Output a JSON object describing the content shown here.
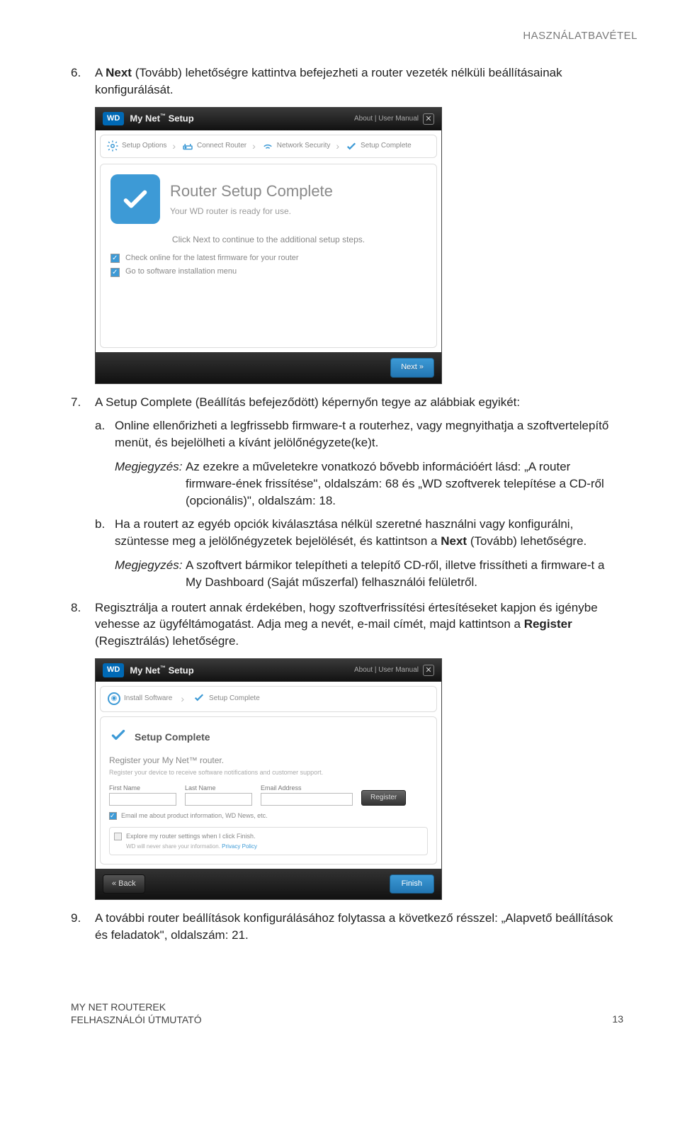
{
  "header": {
    "section": "HASZNÁLATBAVÉTEL"
  },
  "steps": {
    "s6": {
      "num": "6.",
      "text_pre": "A ",
      "text_bold": "Next",
      "text_post": " (Tovább) lehetőségre kattintva befejezheti a router vezeték nélküli beállításainak konfigurálását."
    },
    "s7": {
      "num": "7.",
      "text": "A Setup Complete (Beállítás befejeződött) képernyőn tegye az alábbiak egyikét:"
    },
    "s7a": {
      "letter": "a.",
      "text": "Online ellenőrizheti a legfrissebb firmware-t a routerhez, vagy megnyithatja a szoftvertelepítő menüt, és bejelölheti a kívánt jelölőnégyzete(ke)t."
    },
    "s7a_note": {
      "label": "Megjegyzés:",
      "text": "Az ezekre a műveletekre vonatkozó bővebb információért lásd: „A router firmware-ének frissítése\", oldalszám: 68 és „WD szoftverek telepítése a CD-ről (opcionális)\", oldalszám: 18."
    },
    "s7b": {
      "letter": "b.",
      "text_pre": "Ha a routert az egyéb opciók kiválasztása nélkül szeretné használni vagy konfigurálni, szüntesse meg a jelölőnégyzetek bejelölését, és kattintson a ",
      "text_bold": "Next",
      "text_post": " (Tovább) lehetőségre."
    },
    "s7b_note": {
      "label": "Megjegyzés:",
      "text": "A szoftvert bármikor telepítheti a telepítő CD-ről, illetve frissítheti a firmware-t a My Dashboard (Saját műszerfal) felhasználói felületről."
    },
    "s8": {
      "num": "8.",
      "text_pre": "Regisztrálja a routert annak érdekében, hogy szoftverfrissítési értesítéseket kapjon és igénybe vehesse az ügyféltámogatást. Adja meg a nevét, e-mail címét, majd kattintson a ",
      "text_bold": "Register",
      "text_post": " (Regisztrálás) lehetőségre."
    },
    "s9": {
      "num": "9.",
      "text": "A további router beállítások konfigurálásához folytassa a következő résszel: „Alapvető beállítások és feladatok\", oldalszám: 21."
    }
  },
  "shot1": {
    "logo": "WD",
    "title_pre": "My Net",
    "title_tm": "™",
    "title_post": " Setup",
    "about": "About | User Manual",
    "crumbs": {
      "c1": "Setup Options",
      "c2": "Connect Router",
      "c3": "Network Security",
      "c4": "Setup Complete"
    },
    "complete_title": "Router Setup Complete",
    "complete_sub": "Your WD router is ready for use.",
    "click_next": "Click Next to continue to the additional setup steps.",
    "chk1": "Check online for the latest firmware for your router",
    "chk2": "Go to software installation menu",
    "next": "Next »"
  },
  "shot2": {
    "logo": "WD",
    "title_pre": "My Net",
    "title_tm": "™",
    "title_post": " Setup",
    "about": "About | User Manual",
    "crumb1": "Install Software",
    "crumb2": "Setup Complete",
    "sc_title": "Setup Complete",
    "reg_sub": "Register your My Net™ router.",
    "reg_desc": "Register your device to receive software notifications and customer support.",
    "f1": "First Name",
    "f2": "Last Name",
    "f3": "Email Address",
    "register": "Register",
    "email_me": "Email me about product information, WD News, etc.",
    "explore": "Explore my router settings when I click Finish.",
    "explore_desc": "WD will never share your information. ",
    "privacy": "Privacy Policy",
    "back": "« Back",
    "finish": "Finish"
  },
  "footer": {
    "line1": "MY NET ROUTEREK",
    "line2": "FELHASZNÁLÓI ÚTMUTATÓ",
    "page": "13"
  }
}
